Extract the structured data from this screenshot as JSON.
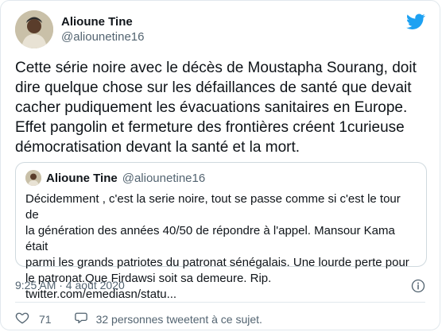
{
  "author": {
    "display_name": "Alioune Tine",
    "handle": "@aliounetine16"
  },
  "tweet": {
    "text": "Cette série noire avec le décès de Moustapha Sourang, doit\ndire quelque chose sur les défaillances de santé que devait\ncacher pudiquement les évacuations sanitaires en Europe.\nEffet pangolin et fermeture des frontières créent 1curieuse\ndémocratisation devant la santé et la mort."
  },
  "quoted": {
    "display_name": "Alioune Tine",
    "handle": "@aliounetine16",
    "text": "Décidemment , c'est la serie noire, tout se passe comme si c'est le tour de\nla génération des années 40/50 de répondre à l'appel. Mansour Kama était\nparmi les grands patriotes du patronat sénégalais.  Une lourde perte pour\nle patronat.Que Firdawsi soit sa demeure. Rip.\ntwitter.com/emediasn/statu..."
  },
  "meta": {
    "timestamp": "9:25 AM · 4 août 2020"
  },
  "actions": {
    "like_count": "71",
    "reply_label": "32 personnes tweetent à ce sujet."
  },
  "icons": {
    "brand": "twitter-bird-icon",
    "info": "info-icon",
    "like": "heart-icon",
    "reply": "speech-bubble-icon"
  },
  "colors": {
    "brand": "#1da1f2",
    "text": "#0f1419",
    "secondary": "#536471",
    "border": "#cfd9de"
  }
}
